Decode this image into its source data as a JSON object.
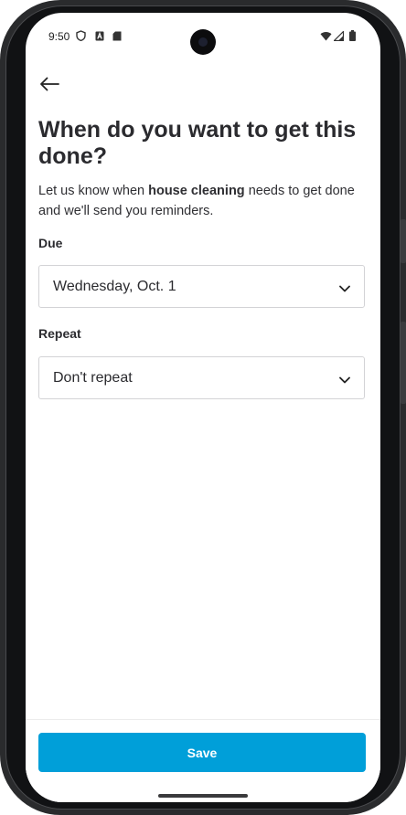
{
  "status_bar": {
    "time": "9:50",
    "left_icons": [
      "shield-icon",
      "font-a-icon",
      "sd-card-icon"
    ],
    "right_icons": [
      "wifi-icon",
      "signal-icon",
      "battery-icon"
    ]
  },
  "header": {
    "back_icon": "arrow-left-icon"
  },
  "main": {
    "title": "When do you want to get this done?",
    "description_prefix": "Let us know when ",
    "description_bold": "house cleaning",
    "description_suffix": " needs to get done and we'll send you reminders.",
    "due": {
      "label": "Due",
      "value": "Wednesday, Oct. 1"
    },
    "repeat": {
      "label": "Repeat",
      "value": "Don't repeat"
    }
  },
  "footer": {
    "save_label": "Save"
  },
  "colors": {
    "accent": "#009fd9",
    "text": "#2b2b2f",
    "border": "#d3d3d6"
  }
}
